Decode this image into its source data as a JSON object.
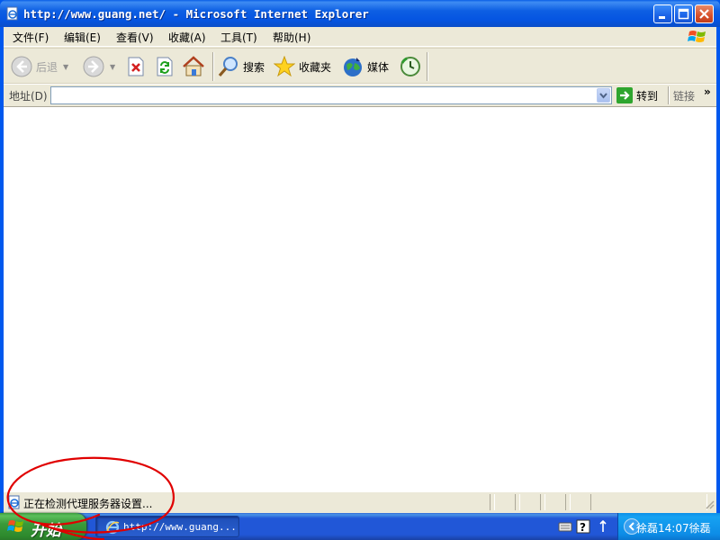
{
  "window": {
    "title": "http://www.guang.net/ - Microsoft Internet Explorer"
  },
  "menubar": {
    "items": [
      {
        "label": "文件(F)"
      },
      {
        "label": "编辑(E)"
      },
      {
        "label": "查看(V)"
      },
      {
        "label": "收藏(A)"
      },
      {
        "label": "工具(T)"
      },
      {
        "label": "帮助(H)"
      }
    ]
  },
  "toolbar": {
    "back_label": "后退",
    "search_label": "搜索",
    "favorites_label": "收藏夹",
    "media_label": "媒体"
  },
  "addressbar": {
    "label": "地址(D)",
    "value": "",
    "go_label": "转到",
    "links_label": "链接",
    "links_chevron": "»"
  },
  "statusbar": {
    "text": "正在检测代理服务器设置..."
  },
  "taskbar": {
    "start_label": "开始",
    "task_label": "http://www.guang...",
    "tray_text": "徐磊14:07徐磊"
  },
  "colors": {
    "titlebar": "#0554e1",
    "start_button": "#3a9a3a",
    "annotation": "#e00000"
  }
}
